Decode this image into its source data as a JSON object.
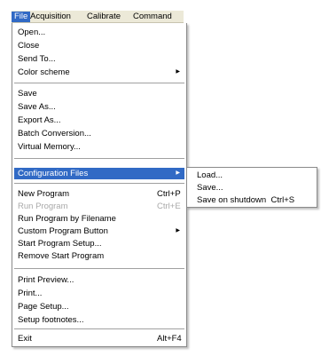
{
  "menubar": {
    "items": [
      "File",
      "Acquisition",
      "Calibrate",
      "Command"
    ]
  },
  "file_menu": {
    "open": "Open...",
    "close": "Close",
    "send_to": "Send To...",
    "color_scheme": "Color scheme",
    "save": "Save",
    "save_as": "Save As...",
    "export_as": "Export As...",
    "batch_conversion": "Batch Conversion...",
    "virtual_memory": "Virtual Memory...",
    "configuration_files": "Configuration Files",
    "new_program": "New Program",
    "new_program_shortcut": "Ctrl+P",
    "run_program": "Run Program",
    "run_program_shortcut": "Ctrl+E",
    "run_program_by_filename": "Run Program by Filename",
    "custom_program_button": "Custom Program Button",
    "start_program_setup": "Start Program Setup...",
    "remove_start_program": "Remove Start Program",
    "print_preview": "Print Preview...",
    "print": "Print...",
    "page_setup": "Page Setup...",
    "setup_footnotes": "Setup footnotes...",
    "exit": "Exit",
    "exit_shortcut": "Alt+F4"
  },
  "config_submenu": {
    "load": "Load...",
    "save": "Save...",
    "save_on_shutdown": "Save on shutdown",
    "save_on_shutdown_shortcut": "Ctrl+S"
  },
  "colors": {
    "highlight": "#316ac5",
    "menubar_bg": "#ece9d8",
    "disabled_text": "#a9a9a9"
  }
}
